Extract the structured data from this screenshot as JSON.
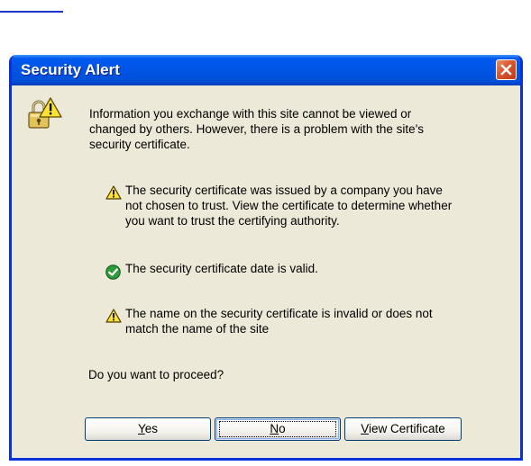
{
  "dialog": {
    "title": "Security Alert",
    "intro_lines": [
      "Information you exchange with this site cannot be viewed or",
      "changed by others. However, there is a problem with the site's",
      "security certificate."
    ],
    "checks": [
      {
        "status": "warning",
        "icon": "warning-icon",
        "lines": [
          "The security certificate was issued by a company you have",
          "not chosen to trust. View the certificate to determine whether",
          "you want to trust the certifying authority."
        ]
      },
      {
        "status": "ok",
        "icon": "checkmark-icon",
        "lines": [
          "The security certificate date is valid."
        ]
      },
      {
        "status": "warning",
        "icon": "warning-icon",
        "lines": [
          "The name on the security certificate is invalid or does not",
          "match the name of the site"
        ]
      }
    ],
    "question": "Do you want to proceed?",
    "buttons": {
      "yes": {
        "mnemonic": "Y",
        "rest": "es"
      },
      "no": {
        "mnemonic": "N",
        "rest": "o"
      },
      "view_certificate": {
        "mnemonic": "V",
        "rest": "iew Certificate"
      }
    },
    "focused_button": "no"
  },
  "colors": {
    "titlebar": "#0054e3",
    "window_border": "#0831d9",
    "dialog_bg": "#ece9d8",
    "close_button": "#d9562c",
    "warning_yellow": "#ffe436",
    "check_green": "#2f9a3a"
  }
}
